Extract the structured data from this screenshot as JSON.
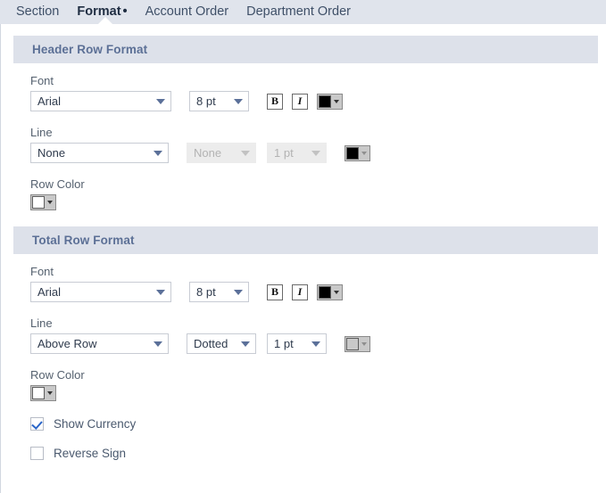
{
  "tabs": [
    {
      "label": "Section",
      "active": false
    },
    {
      "label": "Format",
      "active": true,
      "marker": "•"
    },
    {
      "label": "Account Order",
      "active": false
    },
    {
      "label": "Department Order",
      "active": false
    }
  ],
  "sections": [
    {
      "title": "Header Row Format",
      "font": {
        "label": "Font",
        "family": "Arial",
        "size": "8 pt",
        "bold_label": "B",
        "italic_label": "I",
        "color": "#000000"
      },
      "line": {
        "label": "Line",
        "position": "None",
        "style": "None",
        "style_disabled": true,
        "weight": "1 pt",
        "weight_disabled": true,
        "color": "#000000"
      },
      "row_color": {
        "label": "Row Color",
        "color": "#ffffff"
      }
    },
    {
      "title": "Total Row Format",
      "font": {
        "label": "Font",
        "family": "Arial",
        "size": "8 pt",
        "bold_label": "B",
        "italic_label": "I",
        "color": "#000000"
      },
      "line": {
        "label": "Line",
        "position": "Above Row",
        "style": "Dotted",
        "style_disabled": false,
        "weight": "1 pt",
        "weight_disabled": false,
        "color": "#c9c9c9"
      },
      "row_color": {
        "label": "Row Color",
        "color": "#ffffff"
      }
    }
  ],
  "options": [
    {
      "label": "Show Currency",
      "checked": true
    },
    {
      "label": "Reverse Sign",
      "checked": false
    }
  ],
  "theme": {
    "tabbar_bg": "#e0e4ec",
    "section_header_bg": "#dde1ea",
    "section_header_text": "#5c7096",
    "accent": "#2a65c8"
  }
}
